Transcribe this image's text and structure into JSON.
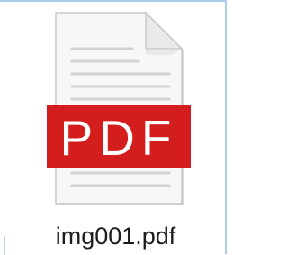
{
  "file": {
    "name": "img001.pdf",
    "type_badge": "PDF",
    "icon": "pdf-file-icon"
  },
  "colors": {
    "badge_red": "#d41d1d",
    "page_background": "#ffffff",
    "selection_border": "#a9cce8",
    "file_name_text": "#1c1c1c"
  }
}
